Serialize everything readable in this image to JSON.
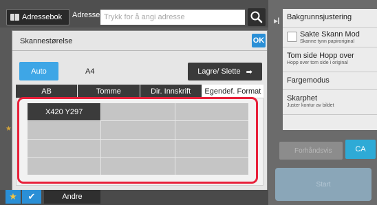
{
  "topbar": {
    "addressbook_label": "Adressebok",
    "address_label": "Adresse",
    "address_placeholder": "Trykk for å angi adresse"
  },
  "dialog": {
    "title": "Skannestørelse",
    "ok_label": "OK",
    "auto_label": "Auto",
    "current_size": "A4",
    "save_delete_label": "Lagre/ Slette",
    "tabs": [
      "AB",
      "Tomme",
      "Dir. Innskrift",
      "Egendef. Format"
    ],
    "active_tab": "Egendef. Format",
    "custom_sizes": [
      "X420 Y297"
    ]
  },
  "right_panel": {
    "items": [
      {
        "title": "Bakgrunnsjustering",
        "subtitle": ""
      },
      {
        "title": "Sakte Skann Mod",
        "subtitle": "Skanne tynn papiroriginal"
      },
      {
        "title": "Tom side Hopp over",
        "subtitle": "Hopp over tom side i original"
      },
      {
        "title": "Fargemodus",
        "subtitle": ""
      },
      {
        "title": "Skarphet",
        "subtitle": "Juster kontur av bildet"
      }
    ],
    "preview_label": "Forhåndsvis",
    "ca_label": "CA",
    "start_label": "Start"
  },
  "bottombar": {
    "others_label": "Andre"
  },
  "colors": {
    "accent_blue": "#3ea6e6",
    "highlight_red": "#e8203a",
    "ca_blue": "#2eaad6"
  }
}
